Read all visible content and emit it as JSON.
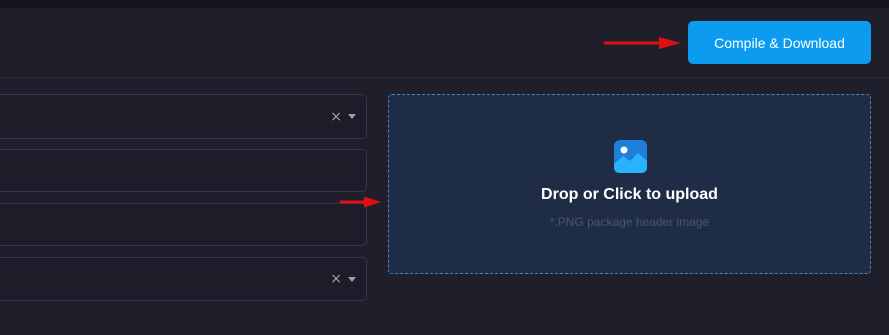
{
  "header": {
    "compile_button_label": "Compile & Download"
  },
  "form": {
    "fields": [
      {
        "type": "select",
        "value": "",
        "clearable": true
      },
      {
        "type": "text",
        "value": ""
      },
      {
        "type": "text",
        "value": ""
      },
      {
        "type": "select",
        "value": "",
        "clearable": true
      }
    ],
    "clear_glyph": "×"
  },
  "upload": {
    "title": "Drop or Click to upload",
    "hint": "*.PNG package header image",
    "icon": "image-icon"
  },
  "colors": {
    "background": "#1e1f2b",
    "accent": "#0d9bf0",
    "dropzone_bg": "#1f2c46",
    "dropzone_border": "#3b87c8",
    "annotation_arrow": "#e01010"
  }
}
